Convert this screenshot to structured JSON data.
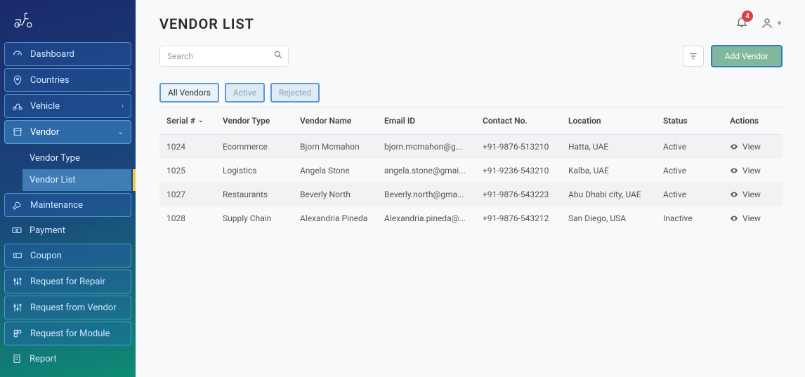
{
  "sidebar": {
    "items": [
      {
        "key": "dashboard",
        "label": "Dashboard"
      },
      {
        "key": "countries",
        "label": "Countries"
      },
      {
        "key": "vehicle",
        "label": "Vehicle",
        "chevron": "right"
      },
      {
        "key": "vendor",
        "label": "Vendor",
        "chevron": "down",
        "sub": [
          {
            "key": "vendor-type",
            "label": "Vendor Type"
          },
          {
            "key": "vendor-list",
            "label": "Vendor List",
            "selected": true
          }
        ]
      },
      {
        "key": "maintenance",
        "label": "Maintenance"
      },
      {
        "key": "payment",
        "label": "Payment",
        "plain": true
      },
      {
        "key": "coupon",
        "label": "Coupon"
      },
      {
        "key": "request-repair",
        "label": "Request for Repair"
      },
      {
        "key": "request-vendor",
        "label": "Request from Vendor"
      },
      {
        "key": "request-module",
        "label": "Request for Module"
      },
      {
        "key": "report",
        "label": "Report",
        "plain": true
      }
    ]
  },
  "header": {
    "title": "VENDOR LIST",
    "notification_count": "4"
  },
  "search": {
    "placeholder": "Search"
  },
  "filter_button": {
    "name": "filter"
  },
  "add_button": {
    "label": "Add Vendor"
  },
  "tabs": [
    {
      "key": "all",
      "label": "All Vendors",
      "active": true
    },
    {
      "key": "active",
      "label": "Active"
    },
    {
      "key": "rejected",
      "label": "Rejected"
    }
  ],
  "table": {
    "columns": [
      "Serial #",
      "Vendor Type",
      "Vendor Name",
      "Email ID",
      "Contact No.",
      "Location",
      "Status",
      "Actions"
    ],
    "action_label": "View",
    "rows": [
      {
        "serial": "1024",
        "type": "Ecommerce",
        "name": "Bjorn Mcmahon",
        "email": "bjorn.mcmahon@g...",
        "contact": "+91-9876-513210",
        "location": "Hatta, UAE",
        "status": "Active"
      },
      {
        "serial": "1025",
        "type": "Logistics",
        "name": "Angela Stone",
        "email": "angela.stone@gmai...",
        "contact": "+91-9236-543210",
        "location": "Kalba, UAE",
        "status": "Active"
      },
      {
        "serial": "1027",
        "type": "Restaurants",
        "name": "Beverly North",
        "email": "Beverly.north@gma...",
        "contact": "+91-9876-543223",
        "location": "Abu Dhabi city, UAE",
        "status": "Active"
      },
      {
        "serial": "1028",
        "type": "Supply Chain",
        "name": "Alexandria Pineda",
        "email": "Alexandria.pineda@...",
        "contact": "+91-9876-543212",
        "location": "San Diego, USA",
        "status": "Inactive"
      }
    ]
  }
}
